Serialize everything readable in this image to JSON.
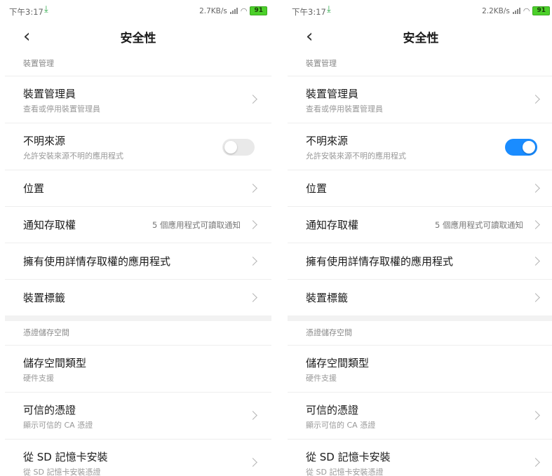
{
  "screens": [
    {
      "status": {
        "time": "下午3:17",
        "speed": "2.7KB/s",
        "battery": "91"
      },
      "toggle_on": false
    },
    {
      "status": {
        "time": "下午3:17",
        "speed": "2.2KB/s",
        "battery": "91"
      },
      "toggle_on": true
    }
  ],
  "header": {
    "title": "安全性"
  },
  "section_device": {
    "label": "裝置管理"
  },
  "items": {
    "device_admin": {
      "title": "裝置管理員",
      "subtitle": "查看或停用裝置管理員"
    },
    "unknown_sources": {
      "title": "不明來源",
      "subtitle": "允許安裝來源不明的應用程式"
    },
    "location": {
      "title": "位置"
    },
    "notification_access": {
      "title": "通知存取權",
      "value": "5 個應用程式可讀取通知"
    },
    "usage_access": {
      "title": "擁有使用詳情存取權的應用程式"
    },
    "device_tags": {
      "title": "裝置標籤"
    },
    "storage_type": {
      "title": "儲存空間類型",
      "subtitle": "硬件支援"
    },
    "trusted_creds": {
      "title": "可信的憑證",
      "subtitle": "顯示可信的 CA 憑證"
    },
    "install_sd": {
      "title": "從 SD 記憶卡安裝",
      "subtitle": "從 SD 記憶卡安裝憑證"
    }
  },
  "section_creds": {
    "label": "憑證儲存空間"
  },
  "colors": {
    "toggle_on": "#1a8cff",
    "toggle_off": "#e9e9e9",
    "battery": "#4cd02a"
  },
  "icons": {
    "back": "chevron-left-icon",
    "row_arrow": "chevron-right-icon",
    "download": "download-arrow-icon",
    "wifi": "wifi-icon",
    "signal": "signal-icon"
  }
}
